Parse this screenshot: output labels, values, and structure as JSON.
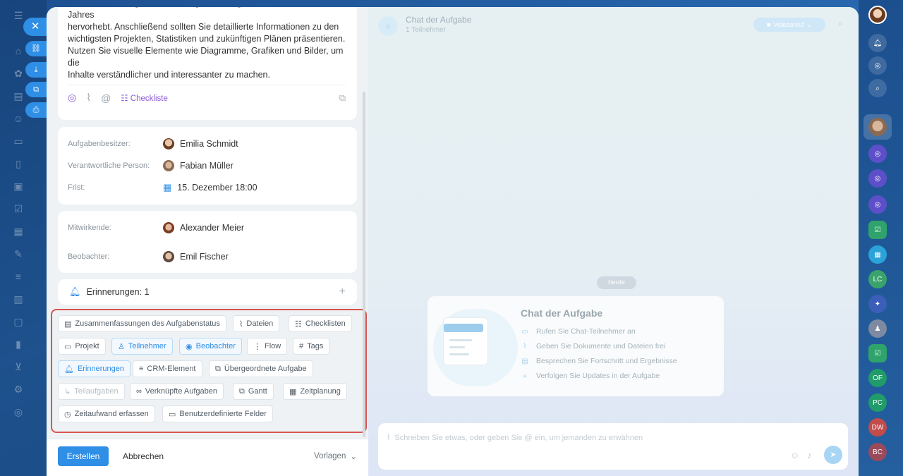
{
  "description": {
    "lines": [
      "kurzen Einführung, die die wichtigsten Erfolge und Meilensteine des Jahres",
      "hervorhebt. Anschließend sollten Sie detaillierte Informationen zu den",
      "wichtigsten Projekten, Statistiken und zukünftigen Plänen präsentieren.",
      "Nutzen Sie visuelle Elemente wie Diagramme, Grafiken und Bilder, um die",
      "Inhalte verständlicher und interessanter zu machen."
    ],
    "checklist_label": "Checkliste"
  },
  "people": {
    "owner_label": "Aufgabenbesitzer:",
    "owner": "Emilia Schmidt",
    "responsible_label": "Verantwortliche Person:",
    "responsible": "Fabian Müller",
    "deadline_label": "Frist:",
    "deadline": "15. Dezember 18:00",
    "participants_label": "Mitwirkende:",
    "participant": "Alexander Meier",
    "observers_label": "Beobachter:",
    "observer": "Emil Fischer"
  },
  "reminders": {
    "label": "Erinnerungen: 1"
  },
  "field_chips": [
    {
      "label": "Zusammenfassungen des Aufgabenstatus",
      "icon": "document-icon",
      "state": "normal"
    },
    {
      "label": "Dateien",
      "icon": "paperclip-icon",
      "state": "normal"
    },
    {
      "label": "Checklisten",
      "icon": "list-icon",
      "state": "normal"
    },
    {
      "label": "Projekt",
      "icon": "folder-icon",
      "state": "normal"
    },
    {
      "label": "Teilnehmer",
      "icon": "user-icon",
      "state": "active"
    },
    {
      "label": "Beobachter",
      "icon": "eye-icon",
      "state": "active"
    },
    {
      "label": "Flow",
      "icon": "flow-icon",
      "state": "normal"
    },
    {
      "label": "Tags",
      "icon": "hash-icon",
      "state": "normal"
    },
    {
      "label": "Erinnerungen",
      "icon": "bell-icon",
      "state": "active"
    },
    {
      "label": "CRM-Element",
      "icon": "crm-icon",
      "state": "normal"
    },
    {
      "label": "Übergeordnete Aufgabe",
      "icon": "parent-task-icon",
      "state": "normal"
    },
    {
      "label": "Teilaufgaben",
      "icon": "subtask-icon",
      "state": "dim"
    },
    {
      "label": "Verknüpfte Aufgaben",
      "icon": "link-icon",
      "state": "normal"
    },
    {
      "label": "Gantt",
      "icon": "gantt-icon",
      "state": "normal"
    },
    {
      "label": "Zeitplanung",
      "icon": "calendar-icon",
      "state": "normal"
    },
    {
      "label": "Zeitaufwand erfassen",
      "icon": "clock-icon",
      "state": "normal"
    },
    {
      "label": "Benutzerdefinierte Felder",
      "icon": "form-icon",
      "state": "normal"
    }
  ],
  "footer": {
    "create": "Erstellen",
    "cancel": "Abbrechen",
    "templates": "Vorlagen"
  },
  "chat": {
    "title": "Chat der Aufgabe",
    "subtitle": "1 Teilnehmer",
    "video_call": "Videoanruf",
    "today": "heute",
    "welcome_title": "Chat der Aufgabe",
    "welcome_items": [
      "Rufen Sie Chat-Teilnehmer an",
      "Geben Sie Dokumente und Dateien frei",
      "Besprechen Sie Fortschritt und Ergebnisse",
      "Verfolgen Sie Updates in der Aufgabe"
    ],
    "placeholder": "Schreiben Sie etwas, oder geben Sie @ ein, um jemanden zu erwähnen"
  },
  "rightbar_badges": [
    "LC",
    "OF",
    "PC",
    "DW",
    "BC"
  ],
  "colors": {
    "accent": "#2f8ee5",
    "highlight_border": "#d9534f",
    "checklist_purple": "#8a5bd6"
  }
}
